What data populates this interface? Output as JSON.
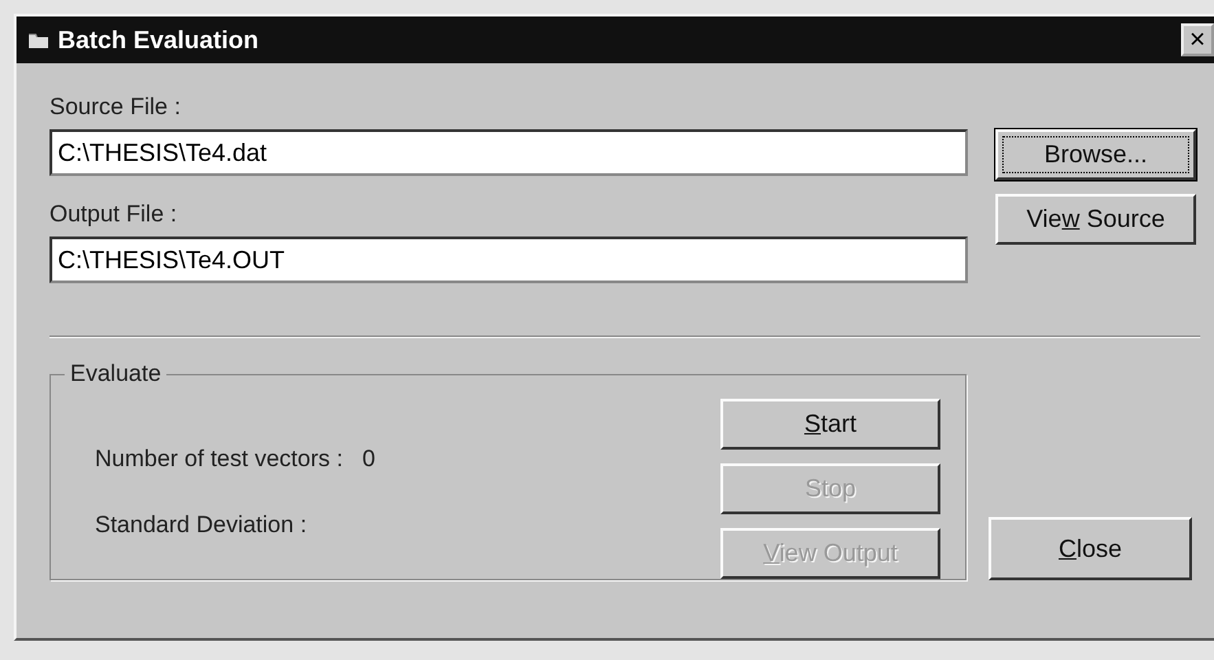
{
  "window": {
    "title": "Batch Evaluation",
    "close_glyph": "×"
  },
  "source": {
    "label": "Source File :",
    "value": "C:\\THESIS\\Te4.dat"
  },
  "output": {
    "label": "Output File :",
    "value": "C:\\THESIS\\Te4.OUT"
  },
  "side_buttons": [
    {
      "label_parts": [
        {
          "text": "Browse...",
          "underlined": false
        }
      ],
      "disabled": false,
      "focused": true
    },
    {
      "label_parts": [
        {
          "text": "Vie",
          "underlined": false
        },
        {
          "text": "w",
          "underlined": true
        },
        {
          "text": " Source",
          "underlined": false
        }
      ],
      "disabled": false,
      "focused": false
    }
  ],
  "evaluate": {
    "title": "Evaluate",
    "stats": [
      {
        "label": "Number of test vectors :",
        "value": "0"
      },
      {
        "label": "Standard Deviation :"
      }
    ],
    "buttons": [
      {
        "label_parts": [
          {
            "text": "S",
            "underlined": true
          },
          {
            "text": "tart",
            "underlined": false
          }
        ],
        "disabled": false,
        "focused": false
      },
      {
        "label_parts": [
          {
            "text": "Stop",
            "underlined": false
          }
        ],
        "disabled": true,
        "focused": false
      },
      {
        "label_parts": [
          {
            "text": "V",
            "underlined": true
          },
          {
            "text": "iew Output",
            "underlined": false
          }
        ],
        "disabled": true,
        "focused": false
      }
    ]
  },
  "close_button": {
    "label_parts": [
      {
        "text": "C",
        "underlined": true
      },
      {
        "text": "lose",
        "underlined": false
      }
    ],
    "disabled": false,
    "focused": false
  }
}
